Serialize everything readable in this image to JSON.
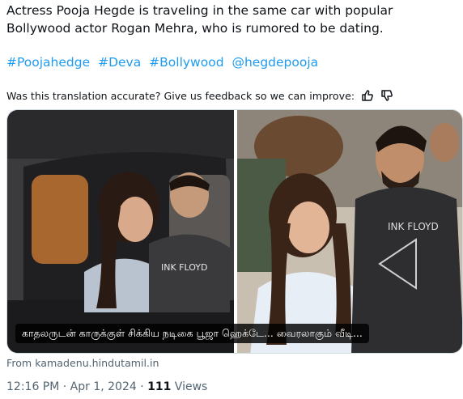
{
  "tweet": {
    "text": "Actress Pooja Hegde is traveling in the same car with popular Bollywood actor Rogan Mehra, who is rumored to be dating.",
    "hashtags": [
      "#Poojahedge",
      "#Deva",
      "#Bollywood",
      "@hegdepooja"
    ]
  },
  "translation": {
    "question": "Was this translation accurate? Give us feedback so we can improve:",
    "thumbs_up_icon": "thumbs-up-icon",
    "thumbs_down_icon": "thumbs-down-icon"
  },
  "card": {
    "caption": "காதலருடன் காருக்குள் சிக்கிய நடிகை பூஜா ஹெக்டே... வைரலாகும் வீடி...",
    "shirt_text_left": "INK FLOYD",
    "shirt_text_right": "INK FLOYD",
    "source": "From kamadenu.hindutamil.in"
  },
  "meta": {
    "time": "12:16 PM · Apr 1, 2024 · ",
    "views_count": "111",
    "views_label": " Views"
  },
  "colors": {
    "link": "#1d9bf0",
    "text": "#0f1419",
    "muted": "#536471",
    "border": "#cfd9de"
  }
}
